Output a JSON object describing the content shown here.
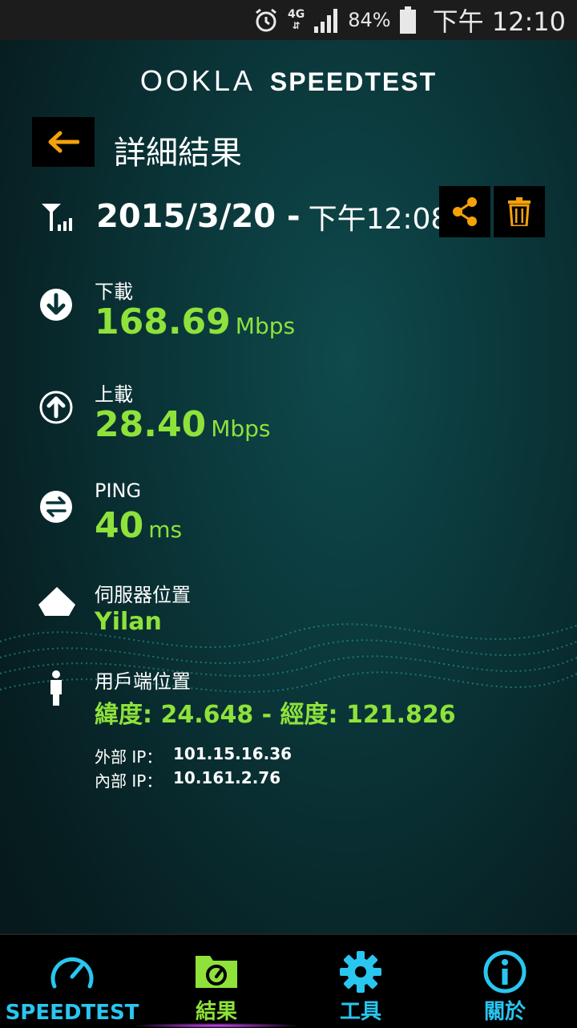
{
  "status_bar": {
    "network": "4G",
    "battery": "84%",
    "time": "下午 12:10"
  },
  "brand": {
    "logo_text": "OOKLA",
    "product": "SPEEDTEST"
  },
  "header": {
    "title": "詳細結果"
  },
  "result": {
    "date": "2015/3/20 -",
    "time": "下午12:08"
  },
  "download": {
    "label": "下載",
    "value": "168.69",
    "unit": "Mbps"
  },
  "upload": {
    "label": "上載",
    "value": "28.40",
    "unit": "Mbps"
  },
  "ping": {
    "label": "PING",
    "value": "40",
    "unit": "ms"
  },
  "server": {
    "label": "伺服器位置",
    "value": "Yilan"
  },
  "client": {
    "label": "用戶端位置",
    "coords": "緯度: 24.648 - 經度: 121.826",
    "external_ip_label": "外部 IP：",
    "external_ip": "101.15.16.36",
    "internal_ip_label": "內部 IP：",
    "internal_ip": "10.161.2.76"
  },
  "nav": [
    {
      "label": "SPEEDTEST",
      "icon": "speedometer-icon",
      "color": "#29c6f0"
    },
    {
      "label": "結果",
      "icon": "results-folder-icon",
      "color": "#8ee23a"
    },
    {
      "label": "工具",
      "icon": "gear-icon",
      "color": "#29c6f0"
    },
    {
      "label": "關於",
      "icon": "info-icon",
      "color": "#29c6f0"
    }
  ],
  "colors": {
    "accent_green": "#8ee23a",
    "accent_orange": "#f5a10a",
    "accent_cyan": "#29c6f0"
  }
}
